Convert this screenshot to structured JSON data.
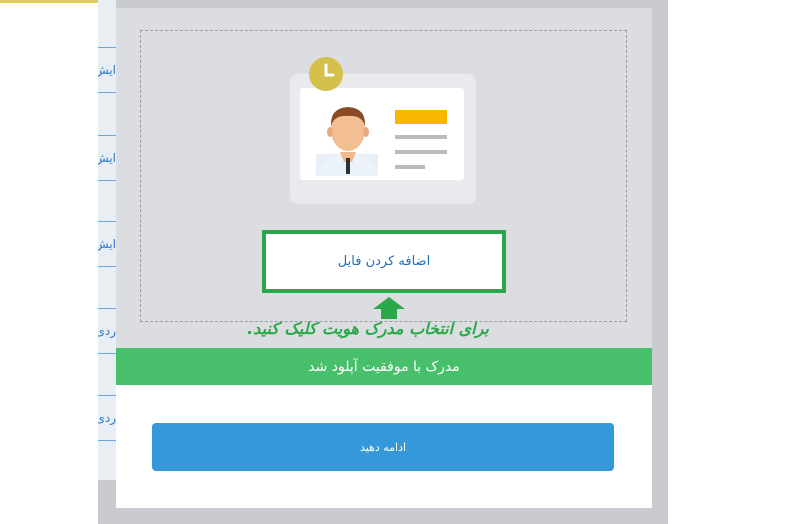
{
  "background": {
    "row_labels": [
      "ایش",
      "ایش",
      "ایش",
      "ردی",
      "ردی"
    ]
  },
  "upload": {
    "add_file_label": "اضافه کردن فایل",
    "instruction": "برای انتخاب مدرک هویت کلیک کنید."
  },
  "status": {
    "success_message": "مدرک با موفقیت آپلود شد"
  },
  "actions": {
    "continue_label": "ادامه دهید"
  },
  "colors": {
    "success_green": "#48bf6a",
    "border_green": "#2aa94a",
    "button_blue": "#3498db",
    "badge_yellow": "#d4c04a",
    "id_accent": "#f9b800"
  },
  "icons": {
    "clock": "clock-icon",
    "person": "person-avatar",
    "arrow": "arrow-up-icon"
  }
}
